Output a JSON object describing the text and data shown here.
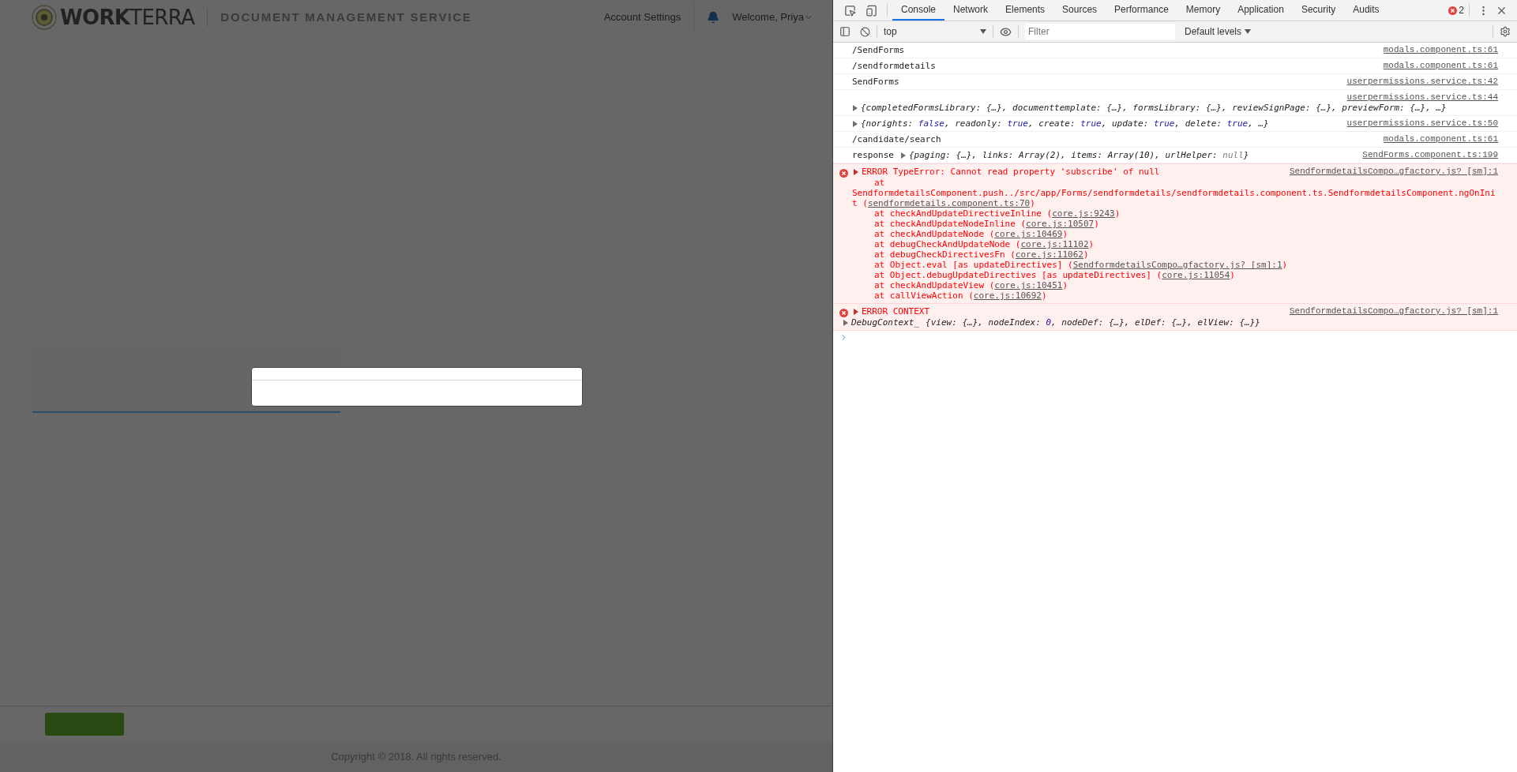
{
  "page": {
    "logo": "**WORK**TERRA",
    "service_title": "DOCUMENT MANAGEMENT SERVICE",
    "account_settings": "Account Settings",
    "welcome": "Welcome, Priya",
    "copyright": "Copyright © 2018. All rights reserved."
  },
  "devtools": {
    "tabs": [
      {
        "label": "Console",
        "selected": true
      },
      {
        "label": "Network",
        "selected": false
      },
      {
        "label": "Elements",
        "selected": false
      },
      {
        "label": "Sources",
        "selected": false
      },
      {
        "label": "Performance",
        "selected": false
      },
      {
        "label": "Memory",
        "selected": false
      },
      {
        "label": "Application",
        "selected": false
      },
      {
        "label": "Security",
        "selected": false
      },
      {
        "label": "Audits",
        "selected": false
      }
    ],
    "error_count": "2",
    "context": "top",
    "filter": {
      "placeholder": "Filter"
    },
    "levels": "Default levels",
    "messages": [
      {
        "kind": "log",
        "text": "/SendForms",
        "source": "modals.component.ts:61"
      },
      {
        "kind": "log",
        "text": "/sendformdetails",
        "source": "modals.component.ts:61"
      },
      {
        "kind": "log",
        "text": "SendForms",
        "source": "userpermissions.service.ts:42"
      },
      {
        "kind": "object",
        "source_above": true,
        "source": "userpermissions.service.ts:44",
        "segments": [
          {
            "text": "{completedFormsLibrary: {…}, documenttemplate: {…}, formsLibrary: {…}, reviewSignPage: {…}, previewForm: {…}, …}",
            "kind": "plain"
          }
        ]
      },
      {
        "kind": "object",
        "source_above": false,
        "source": "userpermissions.service.ts:50",
        "segments": [
          {
            "text": "{norights: ",
            "kind": "plain"
          },
          {
            "text": "false",
            "kind": "keyword"
          },
          {
            "text": ", readonly: ",
            "kind": "plain"
          },
          {
            "text": "true",
            "kind": "keyword"
          },
          {
            "text": ", create: ",
            "kind": "plain"
          },
          {
            "text": "true",
            "kind": "keyword"
          },
          {
            "text": ", update: ",
            "kind": "plain"
          },
          {
            "text": "true",
            "kind": "keyword"
          },
          {
            "text": ", delete: ",
            "kind": "plain"
          },
          {
            "text": "true",
            "kind": "keyword"
          },
          {
            "text": ", …}",
            "kind": "plain"
          }
        ]
      },
      {
        "kind": "log",
        "text": "/candidate/search",
        "source": "modals.component.ts:61"
      },
      {
        "kind": "object",
        "source_above": false,
        "prefix": "response",
        "source": "SendForms.component.ts:199",
        "segments": [
          {
            "text": "{paging: {…}, links: Array(2), items: Array(10), urlHelper: ",
            "kind": "plain"
          },
          {
            "text": "null",
            "kind": "null"
          },
          {
            "text": "}",
            "kind": "plain"
          }
        ]
      },
      {
        "kind": "error",
        "title": "ERROR TypeError: Cannot read property 'subscribe' of null",
        "source": "SendformdetailsCompo…gfactory.js? [sm]:1",
        "stack": [
          {
            "before": "at",
            "indent": true
          },
          {
            "before": "SendformdetailsComponent.push../src/app/Forms/sendformdetails/sendformdetails.component.ts.SendformdetailsComponent.ngOnInit (",
            "link": "sendformdetails.component.ts:70",
            "after": ")",
            "indent": false
          },
          {
            "before": "at checkAndUpdateDirectiveInline (",
            "link": "core.js:9243",
            "after": ")",
            "indent": true
          },
          {
            "before": "at checkAndUpdateNodeInline (",
            "link": "core.js:10507",
            "after": ")",
            "indent": true
          },
          {
            "before": "at checkAndUpdateNode (",
            "link": "core.js:10469",
            "after": ")",
            "indent": true
          },
          {
            "before": "at debugCheckAndUpdateNode (",
            "link": "core.js:11102",
            "after": ")",
            "indent": true
          },
          {
            "before": "at debugCheckDirectivesFn (",
            "link": "core.js:11062",
            "after": ")",
            "indent": true
          },
          {
            "before": "at Object.eval [as updateDirectives] (",
            "link": "SendformdetailsCompo…gfactory.js? [sm]:1",
            "after": ")",
            "indent": true
          },
          {
            "before": "at Object.debugUpdateDirectives [as updateDirectives] (",
            "link": "core.js:11054",
            "after": ")",
            "indent": true
          },
          {
            "before": "at checkAndUpdateView (",
            "link": "core.js:10451",
            "after": ")",
            "indent": true
          },
          {
            "before": "at callViewAction (",
            "link": "core.js:10692",
            "after": ")",
            "indent": true
          }
        ]
      },
      {
        "kind": "error_context",
        "title": "ERROR CONTEXT",
        "source": "SendformdetailsCompo…gfactory.js? [sm]:1",
        "prefix": "DebugContext_",
        "segments": [
          {
            "text": "{view: {…}, nodeIndex: ",
            "kind": "plain"
          },
          {
            "text": "0",
            "kind": "keyword"
          },
          {
            "text": ", nodeDef: {…}, elDef: {…}, elView: {…}}",
            "kind": "plain"
          }
        ]
      }
    ]
  }
}
